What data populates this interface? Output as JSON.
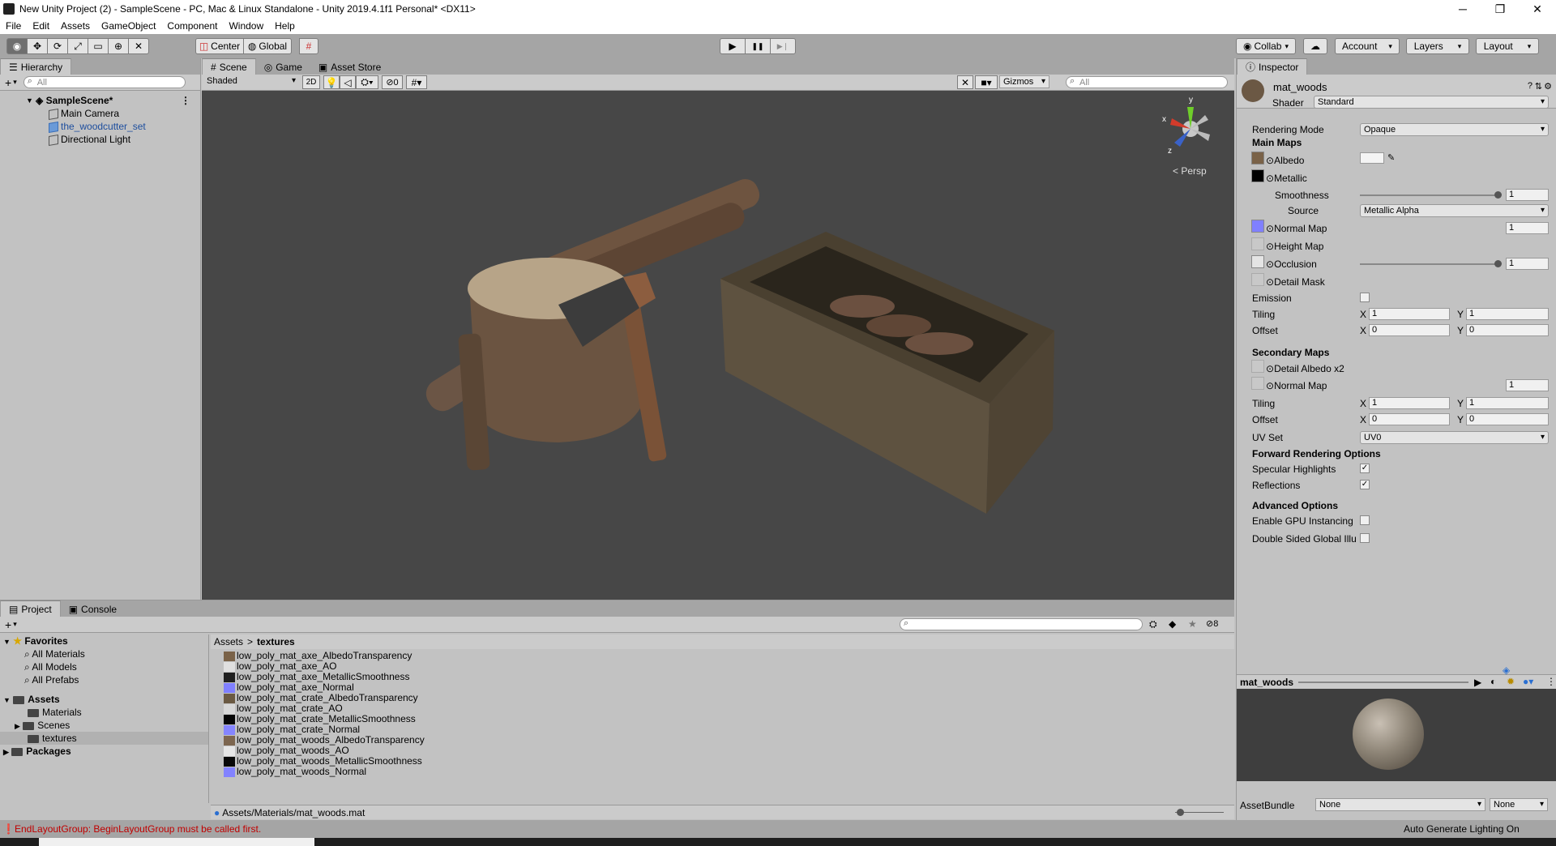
{
  "window": {
    "title": "New Unity Project (2) - SampleScene - PC, Mac & Linux Standalone - Unity 2019.4.1f1 Personal* <DX11>",
    "minimize": "─",
    "maximize": "❐",
    "close": "✕"
  },
  "menu": [
    "File",
    "Edit",
    "Assets",
    "GameObject",
    "Component",
    "Window",
    "Help"
  ],
  "toolbar": {
    "center": "Center",
    "global": "Global",
    "play": "▶",
    "pause": "❚❚",
    "step": "▶❘",
    "collab": "Collab",
    "account": "Account",
    "layers": "Layers",
    "layout": "Layout"
  },
  "hierarchy": {
    "tab": "Hierarchy",
    "search_placeholder": "All",
    "scene": "SampleScene*",
    "items": [
      "Main Camera",
      "the_woodcutter_set",
      "Directional Light"
    ]
  },
  "scene_view": {
    "tabs": [
      "Scene",
      "Game",
      "Asset Store"
    ],
    "shading": "Shaded",
    "mode2d": "2D",
    "hidden_count": "0",
    "gizmos": "Gizmos",
    "search_placeholder": "All",
    "persp": "< Persp",
    "axis_x": "x",
    "axis_y": "y",
    "axis_z": "z"
  },
  "inspector": {
    "tab": "Inspector",
    "material": "mat_woods",
    "shader_label": "Shader",
    "shader": "Standard",
    "rendering_mode_label": "Rendering Mode",
    "rendering_mode": "Opaque",
    "main_maps": "Main Maps",
    "albedo": "Albedo",
    "metallic": "Metallic",
    "smoothness_label": "Smoothness",
    "smoothness": "1",
    "source_label": "Source",
    "source": "Metallic Alpha",
    "normal_map": "Normal Map",
    "normal_value": "1",
    "height_map": "Height Map",
    "occlusion": "Occlusion",
    "occlusion_value": "1",
    "detail_mask": "Detail Mask",
    "emission": "Emission",
    "tiling": "Tiling",
    "offset": "Offset",
    "x": "X",
    "y": "Y",
    "tiling_x": "1",
    "tiling_y": "1",
    "offset_x": "0",
    "offset_y": "0",
    "secondary_maps": "Secondary Maps",
    "detail_albedo": "Detail Albedo x2",
    "normal_map2": "Normal Map",
    "normal_value2": "1",
    "tiling2_x": "1",
    "tiling2_y": "1",
    "offset2_x": "0",
    "offset2_y": "0",
    "uv_set_label": "UV Set",
    "uv_set": "UV0",
    "forward_rendering": "Forward Rendering Options",
    "specular": "Specular Highlights",
    "reflections": "Reflections",
    "check": "✓",
    "advanced": "Advanced Options",
    "gpu_instancing": "Enable GPU Instancing",
    "double_sided": "Double Sided Global Illu",
    "preview_name": "mat_woods",
    "asset_bundle_label": "AssetBundle",
    "asset_bundle": "None",
    "asset_bundle_variant": "None"
  },
  "project": {
    "tabs": [
      "Project",
      "Console"
    ],
    "favorites_label": "Favorites",
    "favorites": [
      "All Materials",
      "All Models",
      "All Prefabs"
    ],
    "assets_label": "Assets",
    "asset_folders": [
      "Materials",
      "Scenes",
      "textures"
    ],
    "packages_label": "Packages",
    "breadcrumb_root": "Assets",
    "breadcrumb_sep": ">",
    "breadcrumb_current": "textures",
    "hidden_count": "8",
    "files": [
      {
        "name": "low_poly_mat_axe_AlbedoTransparency",
        "color": "#7a6248"
      },
      {
        "name": "low_poly_mat_axe_AO",
        "color": "#e0e0e0"
      },
      {
        "name": "low_poly_mat_axe_MetallicSmoothness",
        "color": "#202020"
      },
      {
        "name": "low_poly_mat_axe_Normal",
        "color": "#8080ff"
      },
      {
        "name": "low_poly_mat_crate_AlbedoTransparency",
        "color": "#6b5a43"
      },
      {
        "name": "low_poly_mat_crate_AO",
        "color": "#d8d8d8"
      },
      {
        "name": "low_poly_mat_crate_MetallicSmoothness",
        "color": "#050505"
      },
      {
        "name": "low_poly_mat_crate_Normal",
        "color": "#8585ff"
      },
      {
        "name": "low_poly_mat_woods_AlbedoTransparency",
        "color": "#7d6650"
      },
      {
        "name": "low_poly_mat_woods_AO",
        "color": "#e6e6e6"
      },
      {
        "name": "low_poly_mat_woods_MetallicSmoothness",
        "color": "#080808"
      },
      {
        "name": "low_poly_mat_woods_Normal",
        "color": "#8383ff"
      }
    ],
    "selected_path": "Assets/Materials/mat_woods.mat"
  },
  "status": {
    "error": "EndLayoutGroup: BeginLayoutGroup must be called first.",
    "auto_lighting": "Auto Generate Lighting On"
  },
  "colors": {
    "accent_selection": "#3d6fb6",
    "error": "#c00000",
    "scene_bg": "#474747"
  }
}
